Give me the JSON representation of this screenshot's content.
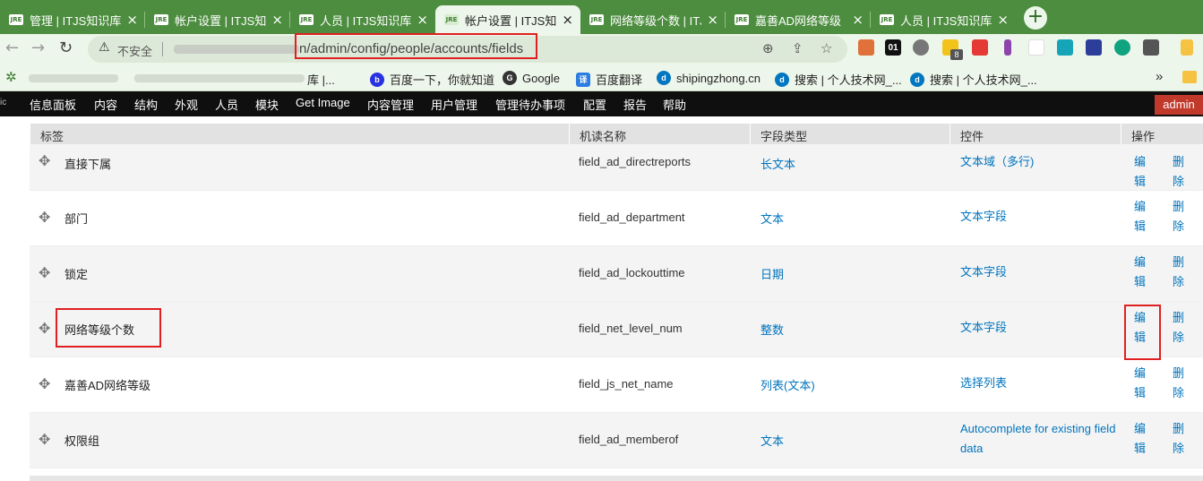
{
  "browser": {
    "tabs": [
      {
        "title": "管理 | ITJS知识库",
        "active": false
      },
      {
        "title": "帐户设置 | ITJS知识",
        "active": false
      },
      {
        "title": "人员 | ITJS知识库",
        "active": false
      },
      {
        "title": "帐户设置 | ITJS知识",
        "active": true
      },
      {
        "title": "网络等级个数 | ITJ",
        "active": false
      },
      {
        "title": "嘉善AD网络等级",
        "active": false
      },
      {
        "title": "人员 | ITJS知识库",
        "active": false
      }
    ],
    "tab_close": "×",
    "favicon_text": "JRE",
    "new_tab": "+",
    "nav": {
      "back": "←",
      "forward": "→",
      "reload": "↻"
    },
    "omnibox": {
      "security_icon": "warning-triangle-icon",
      "security_label": "不安全",
      "url_host_suffix": "n",
      "url_path": "/admin/config/people/accounts/fields"
    },
    "omnibox_buttons": [
      "zoom-icon",
      "share-icon",
      "bookmark-star-icon"
    ],
    "extensions": [
      {
        "name": "tampermonkey-icon",
        "text": "",
        "color": "#e0713a"
      },
      {
        "name": "extension-01-icon",
        "text": "01",
        "color": "#111111"
      },
      {
        "name": "gear-extension-icon",
        "text": "",
        "color": "#777777"
      },
      {
        "name": "note-extension-icon",
        "text": "",
        "color": "#f2c31b"
      },
      {
        "name": "dice-extension-icon",
        "text": "",
        "color": "#e53935"
      },
      {
        "name": "feather-extension-icon",
        "text": "",
        "color": "#8e44ad"
      },
      {
        "name": "blank-extension-icon",
        "text": "",
        "color": "#ffffff"
      },
      {
        "name": "screen-extension-icon",
        "text": "",
        "color": "#16a5b8"
      },
      {
        "name": "cube-extension-icon",
        "text": "",
        "color": "#2c3e9a"
      },
      {
        "name": "gpt-extension-icon",
        "text": "",
        "color": "#10a37f"
      },
      {
        "name": "puzzle-extensions-icon",
        "text": "",
        "color": "#555555"
      },
      {
        "name": "profile-extension-icon",
        "text": "",
        "color": "#f5c242"
      }
    ],
    "extension_badge": "8",
    "bookmarks": [
      {
        "label": "库 |...",
        "icon": "site-icon",
        "color": "#3e7d31"
      },
      {
        "label": "百度一下，你就知道",
        "icon": "baidu-icon",
        "color": "#2932e1"
      },
      {
        "label": "Google",
        "icon": "google-icon",
        "color": "#333333"
      },
      {
        "label": "百度翻译",
        "icon": "baidu-translate-icon",
        "color": "#2b7de1"
      },
      {
        "label": "shipingzhong.cn",
        "icon": "drupal-icon",
        "color": "#0077c0"
      },
      {
        "label": "搜索 | 个人技术网_...",
        "icon": "drupal-icon",
        "color": "#0077c0"
      },
      {
        "label": "搜索 | 个人技术网_...",
        "icon": "drupal-icon",
        "color": "#0077c0"
      }
    ],
    "bookmarks_more": "»"
  },
  "admin_menu": {
    "logo_text": "ic",
    "items": [
      "信息面板",
      "内容",
      "结构",
      "外观",
      "人员",
      "模块",
      "Get Image",
      "内容管理",
      "用户管理",
      "管理待办事项",
      "配置",
      "报告",
      "帮助"
    ],
    "user": "admin"
  },
  "table": {
    "headers": {
      "label": "标签",
      "machine": "机读名称",
      "type": "字段类型",
      "widget": "控件",
      "ops": "操作"
    },
    "drag_glyph": "✥",
    "edit_label": "编辑",
    "delete_label": "删除",
    "rows": [
      {
        "label": "直接下属",
        "machine": "field_ad_directreports",
        "type": "长文本",
        "widget": "文本域（多行)"
      },
      {
        "label": "部门",
        "machine": "field_ad_department",
        "type": "文本",
        "widget": "文本字段"
      },
      {
        "label": "锁定",
        "machine": "field_ad_lockouttime",
        "type": "日期",
        "widget": "文本字段"
      },
      {
        "label": "网络等级个数",
        "machine": "field_net_level_num",
        "type": "整数",
        "widget": "文本字段"
      },
      {
        "label": "嘉善AD网络等级",
        "machine": "field_js_net_name",
        "type": "列表(文本)",
        "widget": "选择列表"
      },
      {
        "label": "权限组",
        "machine": "field_ad_memberof",
        "type": "文本",
        "widget": "Autocomplete for existing field data"
      }
    ]
  }
}
